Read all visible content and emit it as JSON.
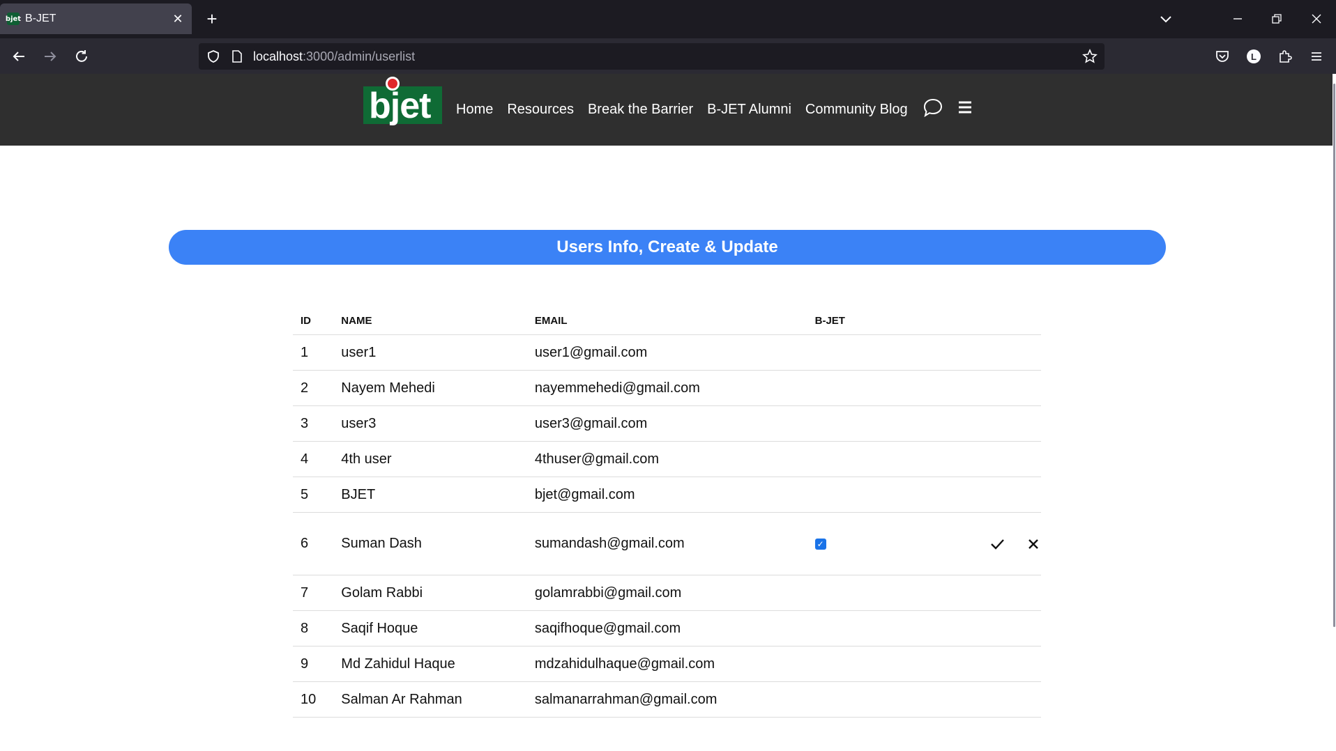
{
  "browser": {
    "tab_title": "B-JET",
    "tab_favicon_text": "bjet",
    "url_host": "localhost",
    "url_path": ":3000/admin/userlist",
    "account_initial": "L"
  },
  "site": {
    "logo_text": "bjet",
    "nav": [
      "Home",
      "Resources",
      "Break the Barrier",
      "B-JET Alumni",
      "Community Blog"
    ],
    "colors": {
      "header": "#2f2f2f",
      "logo_bg": "#0f6b35",
      "logo_dot": "#e0262b",
      "accent": "#3b82f6"
    }
  },
  "page": {
    "title": "Users Info, Create & Update"
  },
  "table": {
    "headers": {
      "id": "ID",
      "name": "NAME",
      "email": "EMAIL",
      "bjet": "B-JET"
    },
    "rows": [
      {
        "id": "1",
        "name": "user1",
        "email": "user1@gmail.com"
      },
      {
        "id": "2",
        "name": "Nayem Mehedi",
        "email": "nayemmehedi@gmail.com"
      },
      {
        "id": "3",
        "name": "user3",
        "email": "user3@gmail.com"
      },
      {
        "id": "4",
        "name": "4th user",
        "email": "4thuser@gmail.com"
      },
      {
        "id": "5",
        "name": "BJET",
        "email": "bjet@gmail.com"
      },
      {
        "id": "6",
        "name": "Suman Dash",
        "email": "sumandash@gmail.com",
        "editing": true,
        "bjet_checked": true
      },
      {
        "id": "7",
        "name": "Golam Rabbi",
        "email": "golamrabbi@gmail.com"
      },
      {
        "id": "8",
        "name": "Saqif Hoque",
        "email": "saqifhoque@gmail.com"
      },
      {
        "id": "9",
        "name": "Md Zahidul Haque",
        "email": "mdzahidulhaque@gmail.com"
      },
      {
        "id": "10",
        "name": "Salman Ar Rahman",
        "email": "salmanarrahman@gmail.com"
      }
    ]
  }
}
